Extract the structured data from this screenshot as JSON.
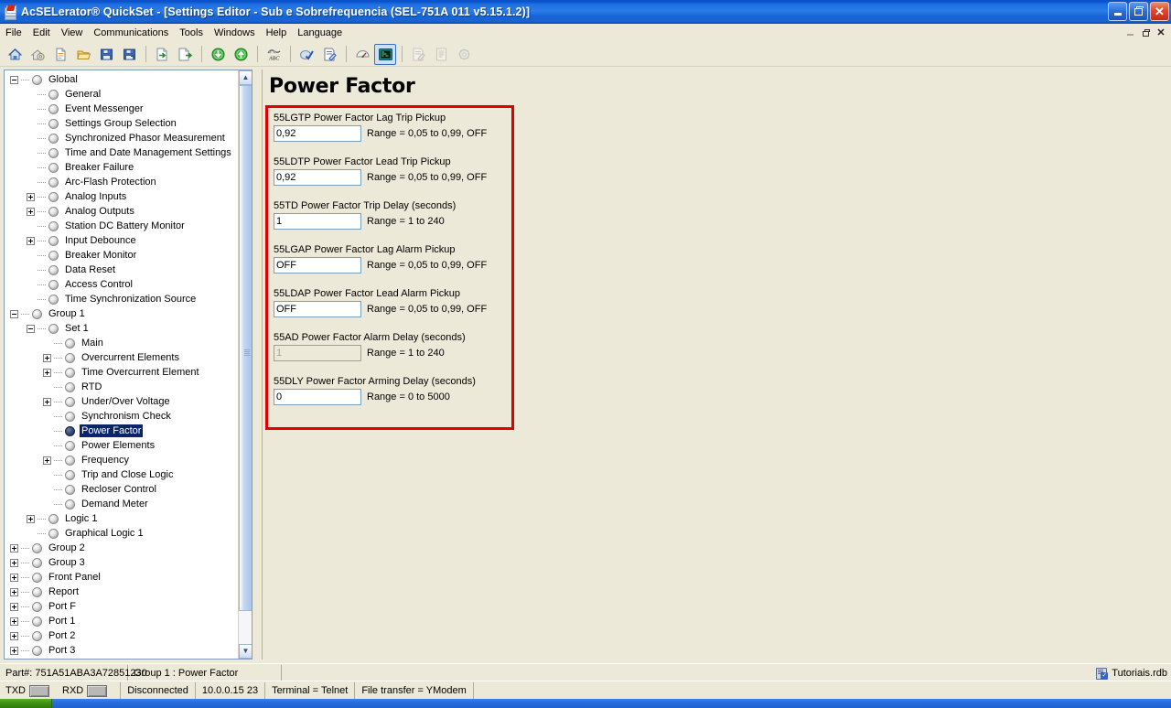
{
  "window": {
    "title": "AcSELerator® QuickSet - [Settings Editor - Sub e Sobrefrequencia (SEL-751A 011 v5.15.1.2)]",
    "app_icon": "quickset-app-icon",
    "min_label": "Minimize",
    "max_label": "Restore",
    "close_label": "Close"
  },
  "menubar": {
    "items": [
      {
        "label": "File"
      },
      {
        "label": "Edit"
      },
      {
        "label": "View"
      },
      {
        "label": "Communications"
      },
      {
        "label": "Tools"
      },
      {
        "label": "Windows"
      },
      {
        "label": "Help"
      },
      {
        "label": "Language"
      }
    ]
  },
  "mdi_buttons": {
    "minimize": "_",
    "restore": "restore",
    "close": "×"
  },
  "toolbar": {
    "buttons": [
      {
        "name": "home-icon",
        "tip": "Home",
        "enabled": true
      },
      {
        "name": "device-settings-icon",
        "tip": "Device Settings",
        "enabled": true
      },
      {
        "name": "new-file-icon",
        "tip": "New",
        "enabled": true
      },
      {
        "name": "open-folder-icon",
        "tip": "Open",
        "enabled": true
      },
      {
        "name": "save-icon",
        "tip": "Save",
        "enabled": true
      },
      {
        "name": "save-as-icon",
        "tip": "Save As",
        "enabled": true
      },
      {
        "name": "import-icon",
        "tip": "Import Settings",
        "enabled": true
      },
      {
        "name": "export-icon",
        "tip": "Export Settings",
        "enabled": true
      },
      {
        "name": "download-icon",
        "tip": "Send Settings to Device",
        "enabled": true
      },
      {
        "name": "upload-icon",
        "tip": "Read Settings from Device",
        "enabled": true
      },
      {
        "name": "spell-check-abc-icon",
        "tip": "Check Settings",
        "enabled": true
      },
      {
        "name": "validate-check-icon",
        "tip": "Validate",
        "enabled": true
      },
      {
        "name": "report-edit-icon",
        "tip": "Settings Report",
        "enabled": true
      },
      {
        "name": "meter-gauge-icon",
        "tip": "Meter",
        "enabled": true
      },
      {
        "name": "terminal-icon",
        "tip": "Terminal",
        "enabled": true,
        "selected": true
      },
      {
        "name": "edit-document-icon",
        "tip": "Edit",
        "enabled": false
      },
      {
        "name": "list-document-icon",
        "tip": "View Report",
        "enabled": false
      },
      {
        "name": "gear-icon",
        "tip": "Options",
        "enabled": false
      }
    ]
  },
  "tree": {
    "nodes": [
      {
        "label": "Global",
        "depth": 0,
        "expander": "minus",
        "selected": false
      },
      {
        "label": "General",
        "depth": 1,
        "expander": "none",
        "selected": false
      },
      {
        "label": "Event Messenger",
        "depth": 1,
        "expander": "none",
        "selected": false
      },
      {
        "label": "Settings Group Selection",
        "depth": 1,
        "expander": "none",
        "selected": false
      },
      {
        "label": "Synchronized Phasor Measurement",
        "depth": 1,
        "expander": "none",
        "selected": false
      },
      {
        "label": "Time and Date Management Settings",
        "depth": 1,
        "expander": "none",
        "selected": false
      },
      {
        "label": "Breaker Failure",
        "depth": 1,
        "expander": "none",
        "selected": false
      },
      {
        "label": "Arc-Flash Protection",
        "depth": 1,
        "expander": "none",
        "selected": false
      },
      {
        "label": "Analog Inputs",
        "depth": 1,
        "expander": "plus",
        "selected": false
      },
      {
        "label": "Analog Outputs",
        "depth": 1,
        "expander": "plus",
        "selected": false
      },
      {
        "label": "Station DC Battery Monitor",
        "depth": 1,
        "expander": "none",
        "selected": false
      },
      {
        "label": "Input Debounce",
        "depth": 1,
        "expander": "plus",
        "selected": false
      },
      {
        "label": "Breaker Monitor",
        "depth": 1,
        "expander": "none",
        "selected": false
      },
      {
        "label": "Data Reset",
        "depth": 1,
        "expander": "none",
        "selected": false
      },
      {
        "label": "Access Control",
        "depth": 1,
        "expander": "none",
        "selected": false
      },
      {
        "label": "Time Synchronization Source",
        "depth": 1,
        "expander": "none",
        "selected": false
      },
      {
        "label": "Group 1",
        "depth": 0,
        "expander": "minus",
        "selected": false
      },
      {
        "label": "Set 1",
        "depth": 1,
        "expander": "minus",
        "selected": false
      },
      {
        "label": "Main",
        "depth": 2,
        "expander": "none",
        "selected": false
      },
      {
        "label": "Overcurrent Elements",
        "depth": 2,
        "expander": "plus",
        "selected": false
      },
      {
        "label": "Time Overcurrent Element",
        "depth": 2,
        "expander": "plus",
        "selected": false
      },
      {
        "label": "RTD",
        "depth": 2,
        "expander": "none",
        "selected": false
      },
      {
        "label": "Under/Over Voltage",
        "depth": 2,
        "expander": "plus",
        "selected": false
      },
      {
        "label": "Synchronism Check",
        "depth": 2,
        "expander": "none",
        "selected": false
      },
      {
        "label": "Power Factor",
        "depth": 2,
        "expander": "none",
        "selected": true
      },
      {
        "label": "Power Elements",
        "depth": 2,
        "expander": "none",
        "selected": false
      },
      {
        "label": "Frequency",
        "depth": 2,
        "expander": "plus",
        "selected": false
      },
      {
        "label": "Trip and Close Logic",
        "depth": 2,
        "expander": "none",
        "selected": false
      },
      {
        "label": "Recloser Control",
        "depth": 2,
        "expander": "none",
        "selected": false
      },
      {
        "label": "Demand Meter",
        "depth": 2,
        "expander": "none",
        "selected": false
      },
      {
        "label": "Logic 1",
        "depth": 1,
        "expander": "plus",
        "selected": false
      },
      {
        "label": "Graphical Logic 1",
        "depth": 1,
        "expander": "none",
        "selected": false
      },
      {
        "label": "Group 2",
        "depth": 0,
        "expander": "plus",
        "selected": false
      },
      {
        "label": "Group 3",
        "depth": 0,
        "expander": "plus",
        "selected": false
      },
      {
        "label": "Front Panel",
        "depth": 0,
        "expander": "plus",
        "selected": false
      },
      {
        "label": "Report",
        "depth": 0,
        "expander": "plus",
        "selected": false
      },
      {
        "label": "Port F",
        "depth": 0,
        "expander": "plus",
        "selected": false
      },
      {
        "label": "Port 1",
        "depth": 0,
        "expander": "plus",
        "selected": false
      },
      {
        "label": "Port 2",
        "depth": 0,
        "expander": "plus",
        "selected": false
      },
      {
        "label": "Port 3",
        "depth": 0,
        "expander": "plus",
        "selected": false
      }
    ],
    "scroll_up": "▲",
    "scroll_down": "▼"
  },
  "page": {
    "title": "Power Factor",
    "fields": [
      {
        "id": "55LGTP",
        "label": "55LGTP  Power Factor Lag Trip Pickup",
        "value": "0,92",
        "range": "Range = 0,05 to 0,99, OFF",
        "disabled": false
      },
      {
        "id": "55LDTP",
        "label": "55LDTP  Power Factor Lead Trip Pickup",
        "value": "0,92",
        "range": "Range = 0,05 to 0,99, OFF",
        "disabled": false
      },
      {
        "id": "55TD",
        "label": "55TD  Power Factor Trip Delay (seconds)",
        "value": "1",
        "range": "Range = 1 to 240",
        "disabled": false
      },
      {
        "id": "55LGAP",
        "label": "55LGAP  Power Factor Lag Alarm Pickup",
        "value": "OFF",
        "range": "Range = 0,05 to 0,99, OFF",
        "disabled": false
      },
      {
        "id": "55LDAP",
        "label": "55LDAP  Power Factor Lead Alarm Pickup",
        "value": "OFF",
        "range": "Range = 0,05 to 0,99, OFF",
        "disabled": false
      },
      {
        "id": "55AD",
        "label": "55AD  Power Factor Alarm Delay (seconds)",
        "value": "1",
        "range": "Range = 1 to 240",
        "disabled": true
      },
      {
        "id": "55DLY",
        "label": "55DLY  Power Factor Arming Delay (seconds)",
        "value": "0",
        "range": "Range = 0 to 5000",
        "disabled": false
      }
    ]
  },
  "statusbar_top": {
    "part_number": "Part#: 751A51ABA3A72851230",
    "path": "Group 1 : Power Factor",
    "database": "Tutoriais.rdb",
    "database_icon": "database-check-icon"
  },
  "statusbar_bottom": {
    "txd_label": "TXD",
    "rxd_label": "RXD",
    "connection": "Disconnected",
    "address": "10.0.0.15  23",
    "terminal": "Terminal = Telnet",
    "file_transfer": "File transfer = YModem"
  },
  "colors": {
    "accent_red": "#e00000",
    "selection_blue": "#0a246a",
    "titlebar_blue": "#2a7ce8",
    "window_face": "#ece9d8"
  }
}
